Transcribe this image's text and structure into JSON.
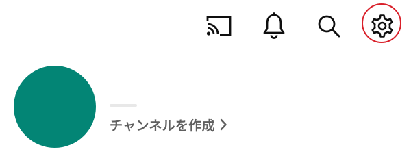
{
  "topbar": {
    "icons": [
      "cast-icon",
      "bell-icon",
      "search-icon",
      "gear-icon"
    ],
    "highlight_color": "#d9202a"
  },
  "profile": {
    "avatar_color": "#038575",
    "create_channel_label": "チャンネルを作成"
  }
}
